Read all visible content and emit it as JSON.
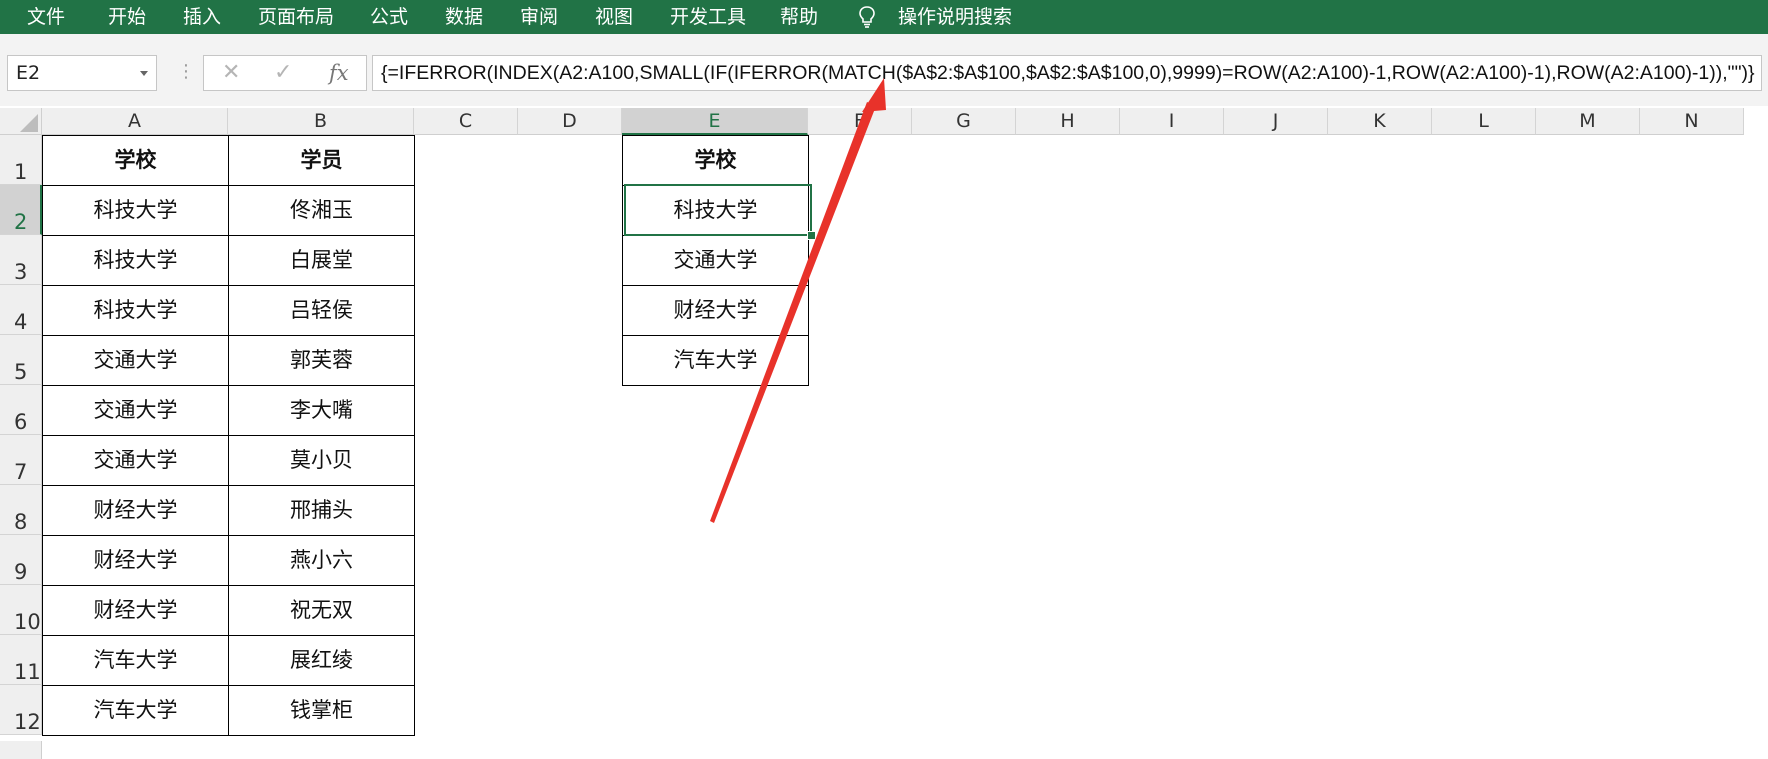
{
  "ribbon": {
    "tabs": [
      "文件",
      "开始",
      "插入",
      "页面布局",
      "公式",
      "数据",
      "审阅",
      "视图",
      "开发工具",
      "帮助"
    ],
    "tell_me": "操作说明搜索"
  },
  "formula_bar": {
    "name_box": "E2",
    "formula": "{=IFERROR(INDEX(A2:A100,SMALL(IF(IFERROR(MATCH($A$2:$A$100,$A$2:$A$100,0),9999)=ROW(A2:A100)-1,ROW(A2:A100)-1),ROW(A2:A100)-1)),\"\")}",
    "cancel_glyph": "✕",
    "enter_glyph": "✓",
    "fx_label": "fx"
  },
  "columns": [
    "A",
    "B",
    "C",
    "D",
    "E",
    "F",
    "G",
    "H",
    "I",
    "J",
    "K",
    "L",
    "M",
    "N"
  ],
  "rows": [
    "1",
    "2",
    "3",
    "4",
    "5",
    "6",
    "7",
    "8",
    "9",
    "10",
    "11",
    "12"
  ],
  "selected": {
    "column": "E",
    "row": "2"
  },
  "source_table": {
    "headers": [
      "学校",
      "学员"
    ],
    "rows": [
      [
        "科技大学",
        "佟湘玉"
      ],
      [
        "科技大学",
        "白展堂"
      ],
      [
        "科技大学",
        "吕轻侯"
      ],
      [
        "交通大学",
        "郭芙蓉"
      ],
      [
        "交通大学",
        "李大嘴"
      ],
      [
        "交通大学",
        "莫小贝"
      ],
      [
        "财经大学",
        "邢捕头"
      ],
      [
        "财经大学",
        "燕小六"
      ],
      [
        "财经大学",
        "祝无双"
      ],
      [
        "汽车大学",
        "展红绫"
      ],
      [
        "汽车大学",
        "钱掌柜"
      ]
    ]
  },
  "result_table": {
    "header": "学校",
    "values": [
      "科技大学",
      "交通大学",
      "财经大学",
      "汽车大学"
    ]
  },
  "colors": {
    "ribbon": "#217346",
    "arrow": "#e8322a"
  }
}
